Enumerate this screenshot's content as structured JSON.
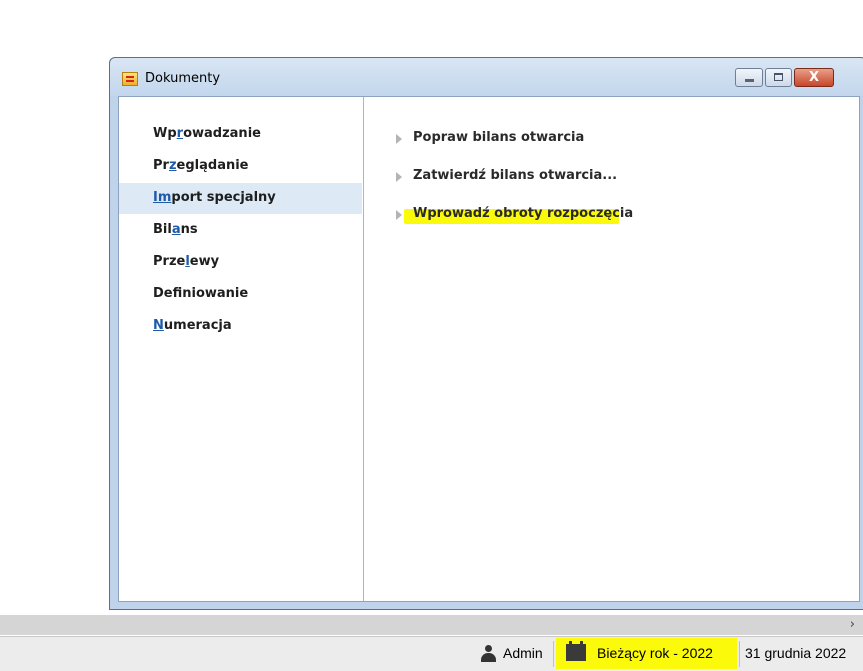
{
  "window": {
    "title": "Dokumenty",
    "buttons": {
      "minimize": "minimize",
      "maximize": "maximize",
      "close": "X"
    }
  },
  "nav": {
    "items": [
      {
        "pre": "Wp",
        "acc": "r",
        "post": "owadzanie",
        "active": false
      },
      {
        "pre": "Pr",
        "acc": "z",
        "post": "eglądanie",
        "active": false
      },
      {
        "pre": "",
        "acc": "Im",
        "post": "port specjalny",
        "active": true
      },
      {
        "pre": "Bil",
        "acc": "a",
        "post": "ns",
        "active": false
      },
      {
        "pre": "Prze",
        "acc": "l",
        "post": "ewy",
        "active": false
      },
      {
        "pre": "Def",
        "acc": "i",
        "post": "niowanie",
        "active": false
      },
      {
        "pre": "",
        "acc": "N",
        "post": "umeracja",
        "active": false
      }
    ]
  },
  "actions": [
    {
      "label": "Popraw bilans otwarcia"
    },
    {
      "label": "Zatwierdź bilans otwarcia..."
    },
    {
      "label": "Wprowadź obroty rozpoczęcia",
      "highlighted": true
    }
  ],
  "statusbar": {
    "user": "Admin",
    "year": "Bieżący rok - 2022",
    "date": "31 grudnia 2022"
  },
  "colors": {
    "highlight": "#fafa0a",
    "accent": "#1e5aa8",
    "active_bg": "#ddeaf6"
  }
}
